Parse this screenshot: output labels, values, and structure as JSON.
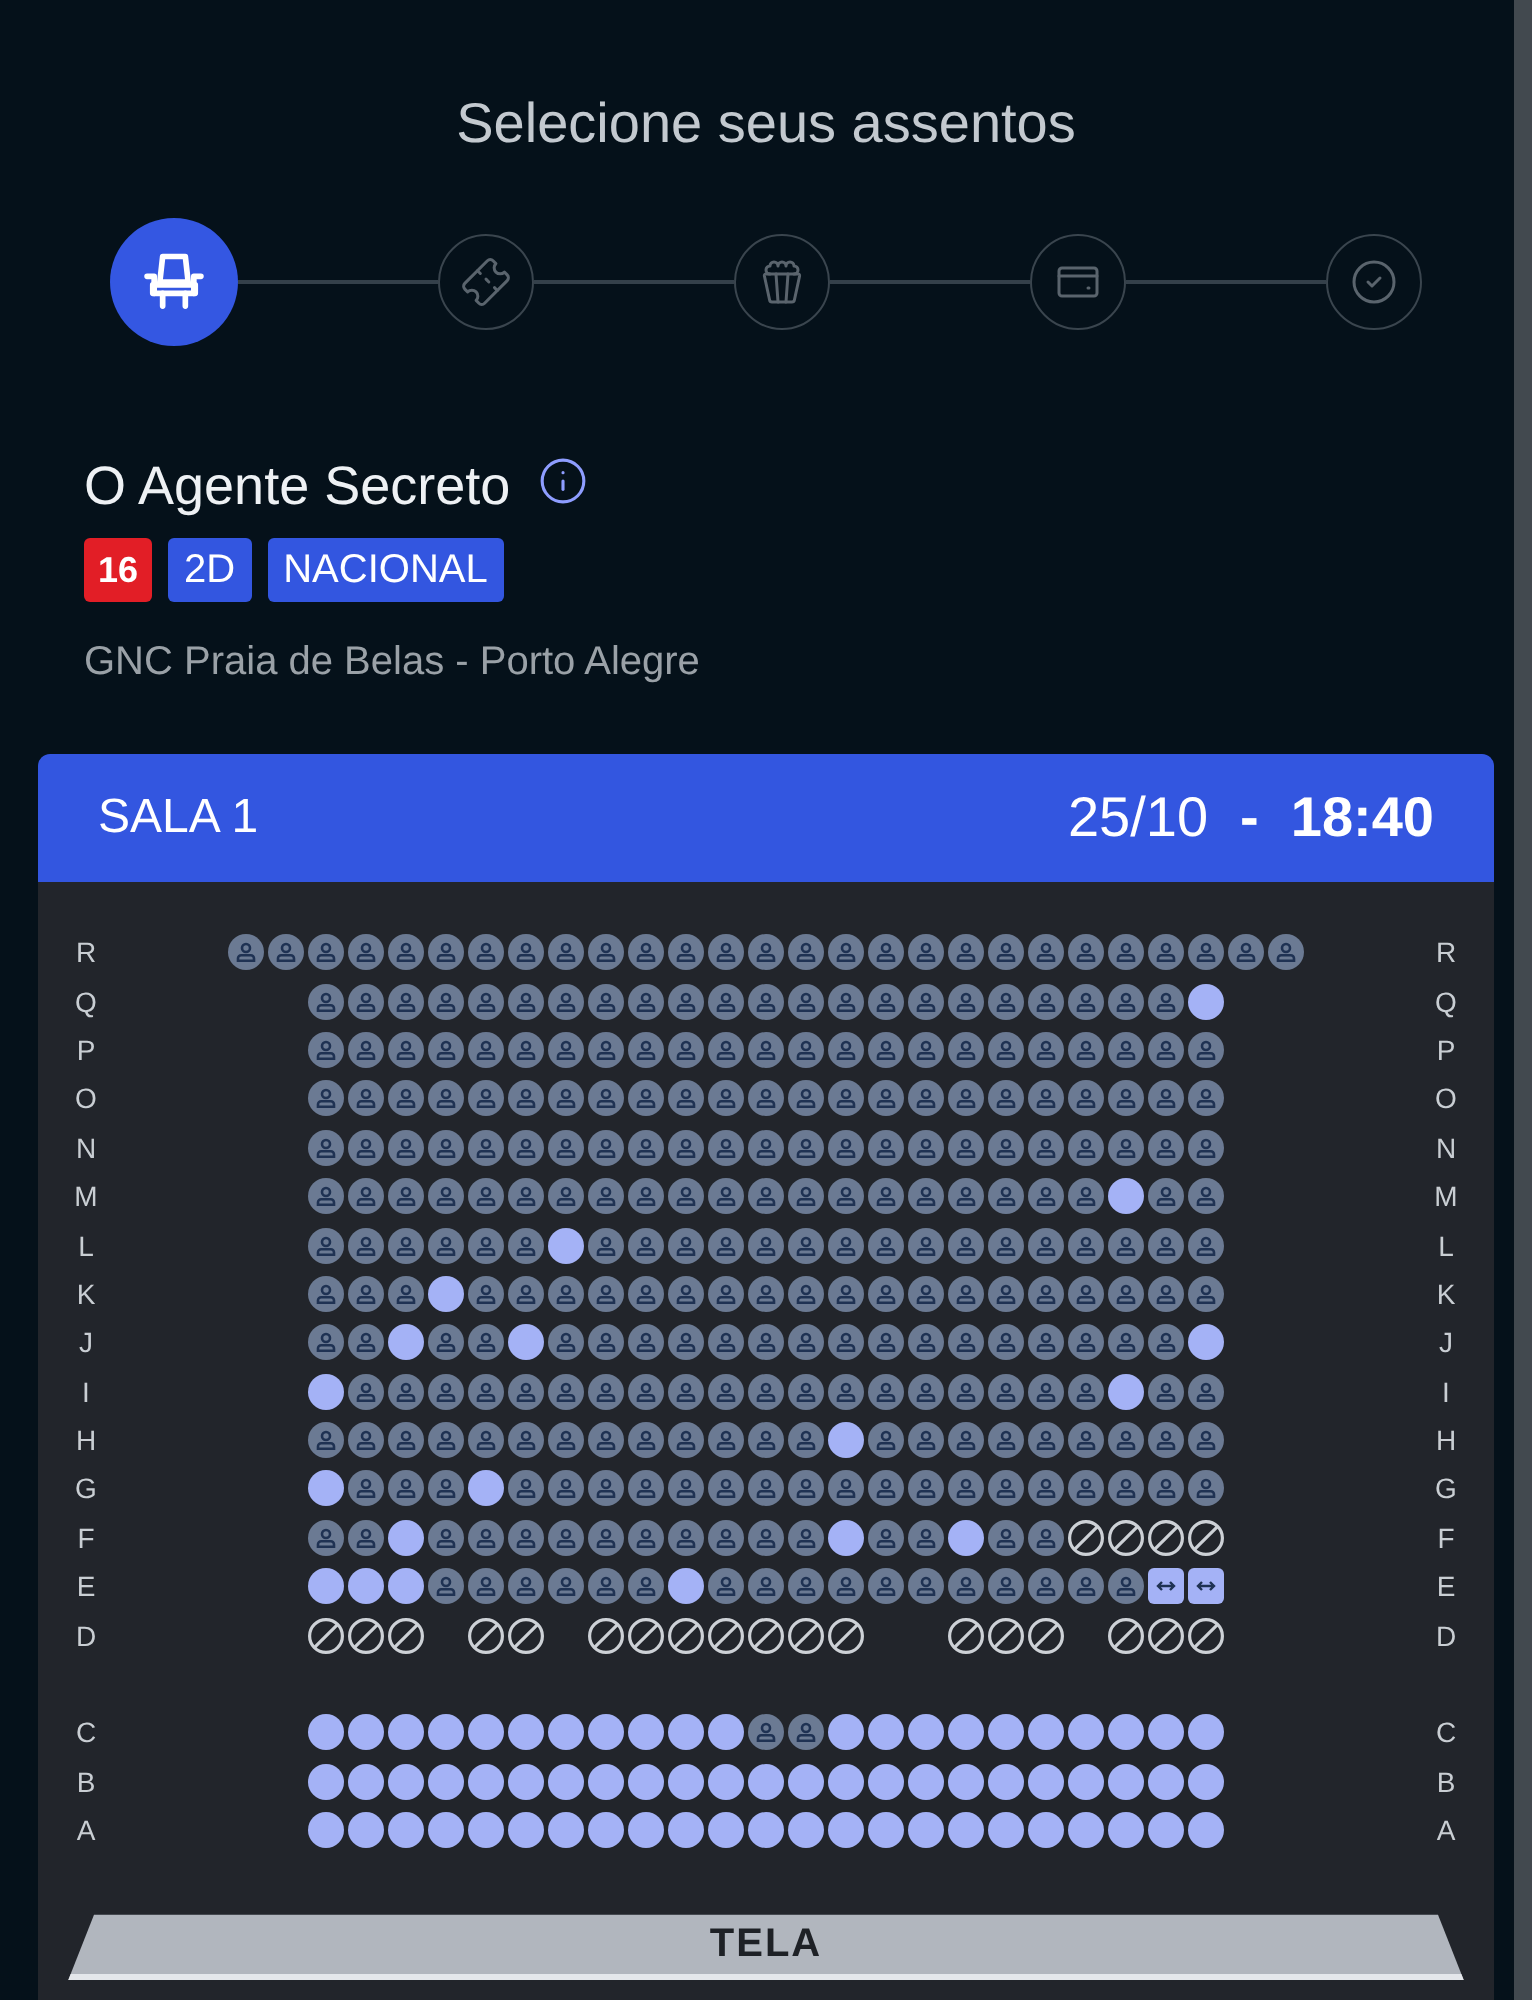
{
  "header": {
    "title": "Selecione seus assentos"
  },
  "steps": [
    {
      "kind": "seat",
      "selected": true
    },
    {
      "kind": "ticket",
      "selected": false
    },
    {
      "kind": "snack",
      "selected": false
    },
    {
      "kind": "payment",
      "selected": false
    },
    {
      "kind": "confirmation",
      "selected": false
    }
  ],
  "movie": {
    "title": "O Agente Secreto",
    "badges": [
      {
        "kind": "rating",
        "text": "16",
        "color": "#e21e26"
      },
      {
        "kind": "tag",
        "text": "2D",
        "color": "#3356e0"
      },
      {
        "kind": "tag",
        "text": "NACIONAL",
        "color": "#3356e0"
      }
    ],
    "location": "GNC Praia de Belas - Porto Alegre"
  },
  "session": {
    "room": "SALA 1",
    "date": "25/10",
    "separator": "-",
    "time": "18:40"
  },
  "seat_map": {
    "blocks": [
      {
        "rows": [
          {
            "label_left": "R",
            "label_right": "R",
            "seats": [
              {
                "kind": "taken"
              },
              {
                "kind": "taken"
              },
              {
                "kind": "taken"
              },
              {
                "kind": "taken"
              },
              {
                "kind": "taken"
              },
              {
                "kind": "taken"
              },
              {
                "kind": "taken"
              },
              {
                "kind": "taken"
              },
              {
                "kind": "taken"
              },
              {
                "kind": "taken"
              },
              {
                "kind": "taken"
              },
              {
                "kind": "taken"
              },
              {
                "kind": "taken"
              },
              {
                "kind": "taken"
              },
              {
                "kind": "taken"
              },
              {
                "kind": "taken"
              },
              {
                "kind": "taken"
              },
              {
                "kind": "taken"
              },
              {
                "kind": "taken"
              },
              {
                "kind": "taken"
              },
              {
                "kind": "taken"
              },
              {
                "kind": "taken"
              },
              {
                "kind": "taken"
              },
              {
                "kind": "taken"
              },
              {
                "kind": "taken"
              },
              {
                "kind": "taken"
              },
              {
                "kind": "taken"
              }
            ]
          },
          {
            "label_left": "Q",
            "label_right": "Q",
            "seats": [
              {
                "kind": "taken"
              },
              {
                "kind": "taken"
              },
              {
                "kind": "taken"
              },
              {
                "kind": "taken"
              },
              {
                "kind": "taken"
              },
              {
                "kind": "taken"
              },
              {
                "kind": "taken"
              },
              {
                "kind": "taken"
              },
              {
                "kind": "taken"
              },
              {
                "kind": "taken"
              },
              {
                "kind": "taken"
              },
              {
                "kind": "taken"
              },
              {
                "kind": "taken"
              },
              {
                "kind": "taken"
              },
              {
                "kind": "taken"
              },
              {
                "kind": "taken"
              },
              {
                "kind": "taken"
              },
              {
                "kind": "taken"
              },
              {
                "kind": "taken"
              },
              {
                "kind": "taken"
              },
              {
                "kind": "taken"
              },
              {
                "kind": "taken"
              },
              {
                "kind": "free"
              }
            ]
          },
          {
            "label_left": "P",
            "label_right": "P",
            "seats": [
              {
                "kind": "taken"
              },
              {
                "kind": "taken"
              },
              {
                "kind": "taken"
              },
              {
                "kind": "taken"
              },
              {
                "kind": "taken"
              },
              {
                "kind": "taken"
              },
              {
                "kind": "taken"
              },
              {
                "kind": "taken"
              },
              {
                "kind": "taken"
              },
              {
                "kind": "taken"
              },
              {
                "kind": "taken"
              },
              {
                "kind": "taken"
              },
              {
                "kind": "taken"
              },
              {
                "kind": "taken"
              },
              {
                "kind": "taken"
              },
              {
                "kind": "taken"
              },
              {
                "kind": "taken"
              },
              {
                "kind": "taken"
              },
              {
                "kind": "taken"
              },
              {
                "kind": "taken"
              },
              {
                "kind": "taken"
              },
              {
                "kind": "taken"
              },
              {
                "kind": "taken"
              }
            ]
          },
          {
            "label_left": "O",
            "label_right": "O",
            "seats": [
              {
                "kind": "taken"
              },
              {
                "kind": "taken"
              },
              {
                "kind": "taken"
              },
              {
                "kind": "taken"
              },
              {
                "kind": "taken"
              },
              {
                "kind": "taken"
              },
              {
                "kind": "taken"
              },
              {
                "kind": "taken"
              },
              {
                "kind": "taken"
              },
              {
                "kind": "taken"
              },
              {
                "kind": "taken"
              },
              {
                "kind": "taken"
              },
              {
                "kind": "taken"
              },
              {
                "kind": "taken"
              },
              {
                "kind": "taken"
              },
              {
                "kind": "taken"
              },
              {
                "kind": "taken"
              },
              {
                "kind": "taken"
              },
              {
                "kind": "taken"
              },
              {
                "kind": "taken"
              },
              {
                "kind": "taken"
              },
              {
                "kind": "taken"
              },
              {
                "kind": "taken"
              }
            ]
          },
          {
            "label_left": "N",
            "label_right": "N",
            "seats": [
              {
                "kind": "taken"
              },
              {
                "kind": "taken"
              },
              {
                "kind": "taken"
              },
              {
                "kind": "taken"
              },
              {
                "kind": "taken"
              },
              {
                "kind": "taken"
              },
              {
                "kind": "taken"
              },
              {
                "kind": "taken"
              },
              {
                "kind": "taken"
              },
              {
                "kind": "taken"
              },
              {
                "kind": "taken"
              },
              {
                "kind": "taken"
              },
              {
                "kind": "taken"
              },
              {
                "kind": "taken"
              },
              {
                "kind": "taken"
              },
              {
                "kind": "taken"
              },
              {
                "kind": "taken"
              },
              {
                "kind": "taken"
              },
              {
                "kind": "taken"
              },
              {
                "kind": "taken"
              },
              {
                "kind": "taken"
              },
              {
                "kind": "taken"
              },
              {
                "kind": "taken"
              }
            ]
          },
          {
            "label_left": "M",
            "label_right": "M",
            "seats": [
              {
                "kind": "taken"
              },
              {
                "kind": "taken"
              },
              {
                "kind": "taken"
              },
              {
                "kind": "taken"
              },
              {
                "kind": "taken"
              },
              {
                "kind": "taken"
              },
              {
                "kind": "taken"
              },
              {
                "kind": "taken"
              },
              {
                "kind": "taken"
              },
              {
                "kind": "taken"
              },
              {
                "kind": "taken"
              },
              {
                "kind": "taken"
              },
              {
                "kind": "taken"
              },
              {
                "kind": "taken"
              },
              {
                "kind": "taken"
              },
              {
                "kind": "taken"
              },
              {
                "kind": "taken"
              },
              {
                "kind": "taken"
              },
              {
                "kind": "taken"
              },
              {
                "kind": "taken"
              },
              {
                "kind": "free"
              },
              {
                "kind": "taken"
              },
              {
                "kind": "taken"
              }
            ]
          },
          {
            "label_left": "L",
            "label_right": "L",
            "seats": [
              {
                "kind": "taken"
              },
              {
                "kind": "taken"
              },
              {
                "kind": "taken"
              },
              {
                "kind": "taken"
              },
              {
                "kind": "taken"
              },
              {
                "kind": "taken"
              },
              {
                "kind": "free"
              },
              {
                "kind": "taken"
              },
              {
                "kind": "taken"
              },
              {
                "kind": "taken"
              },
              {
                "kind": "taken"
              },
              {
                "kind": "taken"
              },
              {
                "kind": "taken"
              },
              {
                "kind": "taken"
              },
              {
                "kind": "taken"
              },
              {
                "kind": "taken"
              },
              {
                "kind": "taken"
              },
              {
                "kind": "taken"
              },
              {
                "kind": "taken"
              },
              {
                "kind": "taken"
              },
              {
                "kind": "taken"
              },
              {
                "kind": "taken"
              },
              {
                "kind": "taken"
              }
            ]
          },
          {
            "label_left": "K",
            "label_right": "K",
            "seats": [
              {
                "kind": "taken"
              },
              {
                "kind": "taken"
              },
              {
                "kind": "taken"
              },
              {
                "kind": "free"
              },
              {
                "kind": "taken"
              },
              {
                "kind": "taken"
              },
              {
                "kind": "taken"
              },
              {
                "kind": "taken"
              },
              {
                "kind": "taken"
              },
              {
                "kind": "taken"
              },
              {
                "kind": "taken"
              },
              {
                "kind": "taken"
              },
              {
                "kind": "taken"
              },
              {
                "kind": "taken"
              },
              {
                "kind": "taken"
              },
              {
                "kind": "taken"
              },
              {
                "kind": "taken"
              },
              {
                "kind": "taken"
              },
              {
                "kind": "taken"
              },
              {
                "kind": "taken"
              },
              {
                "kind": "taken"
              },
              {
                "kind": "taken"
              },
              {
                "kind": "taken"
              }
            ]
          },
          {
            "label_left": "J",
            "label_right": "J",
            "seats": [
              {
                "kind": "taken"
              },
              {
                "kind": "taken"
              },
              {
                "kind": "free"
              },
              {
                "kind": "taken"
              },
              {
                "kind": "taken"
              },
              {
                "kind": "free"
              },
              {
                "kind": "taken"
              },
              {
                "kind": "taken"
              },
              {
                "kind": "taken"
              },
              {
                "kind": "taken"
              },
              {
                "kind": "taken"
              },
              {
                "kind": "taken"
              },
              {
                "kind": "taken"
              },
              {
                "kind": "taken"
              },
              {
                "kind": "taken"
              },
              {
                "kind": "taken"
              },
              {
                "kind": "taken"
              },
              {
                "kind": "taken"
              },
              {
                "kind": "taken"
              },
              {
                "kind": "taken"
              },
              {
                "kind": "taken"
              },
              {
                "kind": "taken"
              },
              {
                "kind": "free"
              }
            ]
          },
          {
            "label_left": "I",
            "label_right": "I",
            "seats": [
              {
                "kind": "free"
              },
              {
                "kind": "taken"
              },
              {
                "kind": "taken"
              },
              {
                "kind": "taken"
              },
              {
                "kind": "taken"
              },
              {
                "kind": "taken"
              },
              {
                "kind": "taken"
              },
              {
                "kind": "taken"
              },
              {
                "kind": "taken"
              },
              {
                "kind": "taken"
              },
              {
                "kind": "taken"
              },
              {
                "kind": "taken"
              },
              {
                "kind": "taken"
              },
              {
                "kind": "taken"
              },
              {
                "kind": "taken"
              },
              {
                "kind": "taken"
              },
              {
                "kind": "taken"
              },
              {
                "kind": "taken"
              },
              {
                "kind": "taken"
              },
              {
                "kind": "taken"
              },
              {
                "kind": "free"
              },
              {
                "kind": "taken"
              },
              {
                "kind": "taken"
              }
            ]
          },
          {
            "label_left": "H",
            "label_right": "H",
            "seats": [
              {
                "kind": "taken"
              },
              {
                "kind": "taken"
              },
              {
                "kind": "taken"
              },
              {
                "kind": "taken"
              },
              {
                "kind": "taken"
              },
              {
                "kind": "taken"
              },
              {
                "kind": "taken"
              },
              {
                "kind": "taken"
              },
              {
                "kind": "taken"
              },
              {
                "kind": "taken"
              },
              {
                "kind": "taken"
              },
              {
                "kind": "taken"
              },
              {
                "kind": "taken"
              },
              {
                "kind": "free"
              },
              {
                "kind": "taken"
              },
              {
                "kind": "taken"
              },
              {
                "kind": "taken"
              },
              {
                "kind": "taken"
              },
              {
                "kind": "taken"
              },
              {
                "kind": "taken"
              },
              {
                "kind": "taken"
              },
              {
                "kind": "taken"
              },
              {
                "kind": "taken"
              }
            ]
          },
          {
            "label_left": "G",
            "label_right": "G",
            "seats": [
              {
                "kind": "free"
              },
              {
                "kind": "taken"
              },
              {
                "kind": "taken"
              },
              {
                "kind": "taken"
              },
              {
                "kind": "free"
              },
              {
                "kind": "taken"
              },
              {
                "kind": "taken"
              },
              {
                "kind": "taken"
              },
              {
                "kind": "taken"
              },
              {
                "kind": "taken"
              },
              {
                "kind": "taken"
              },
              {
                "kind": "taken"
              },
              {
                "kind": "taken"
              },
              {
                "kind": "taken"
              },
              {
                "kind": "taken"
              },
              {
                "kind": "taken"
              },
              {
                "kind": "taken"
              },
              {
                "kind": "taken"
              },
              {
                "kind": "taken"
              },
              {
                "kind": "taken"
              },
              {
                "kind": "taken"
              },
              {
                "kind": "taken"
              },
              {
                "kind": "taken"
              }
            ]
          },
          {
            "label_left": "F",
            "label_right": "F",
            "seats": [
              {
                "kind": "taken"
              },
              {
                "kind": "taken"
              },
              {
                "kind": "free"
              },
              {
                "kind": "taken"
              },
              {
                "kind": "taken"
              },
              {
                "kind": "taken"
              },
              {
                "kind": "taken"
              },
              {
                "kind": "taken"
              },
              {
                "kind": "taken"
              },
              {
                "kind": "taken"
              },
              {
                "kind": "taken"
              },
              {
                "kind": "taken"
              },
              {
                "kind": "taken"
              },
              {
                "kind": "free"
              },
              {
                "kind": "taken"
              },
              {
                "kind": "taken"
              },
              {
                "kind": "free"
              },
              {
                "kind": "taken"
              },
              {
                "kind": "taken"
              },
              {
                "kind": "blocked"
              },
              {
                "kind": "blocked"
              },
              {
                "kind": "blocked"
              },
              {
                "kind": "blocked"
              }
            ]
          },
          {
            "label_left": "E",
            "label_right": "E",
            "seats": [
              {
                "kind": "free"
              },
              {
                "kind": "free"
              },
              {
                "kind": "free"
              },
              {
                "kind": "taken"
              },
              {
                "kind": "taken"
              },
              {
                "kind": "taken"
              },
              {
                "kind": "taken"
              },
              {
                "kind": "taken"
              },
              {
                "kind": "taken"
              },
              {
                "kind": "free"
              },
              {
                "kind": "taken"
              },
              {
                "kind": "taken"
              },
              {
                "kind": "taken"
              },
              {
                "kind": "taken"
              },
              {
                "kind": "taken"
              },
              {
                "kind": "taken"
              },
              {
                "kind": "taken"
              },
              {
                "kind": "taken"
              },
              {
                "kind": "taken"
              },
              {
                "kind": "taken"
              },
              {
                "kind": "taken"
              },
              {
                "kind": "special"
              },
              {
                "kind": "special"
              }
            ]
          },
          {
            "label_left": "D",
            "label_right": "D",
            "seats": [
              {
                "kind": "blocked"
              },
              {
                "kind": "blocked"
              },
              {
                "kind": "blocked"
              },
              {
                "kind": "gap"
              },
              {
                "kind": "blocked"
              },
              {
                "kind": "blocked"
              },
              {
                "kind": "gap"
              },
              {
                "kind": "blocked"
              },
              {
                "kind": "blocked"
              },
              {
                "kind": "blocked"
              },
              {
                "kind": "blocked"
              },
              {
                "kind": "blocked"
              },
              {
                "kind": "blocked"
              },
              {
                "kind": "blocked"
              },
              {
                "kind": "gap"
              },
              {
                "kind": "gap"
              },
              {
                "kind": "blocked"
              },
              {
                "kind": "blocked"
              },
              {
                "kind": "blocked"
              },
              {
                "kind": "gap"
              },
              {
                "kind": "blocked"
              },
              {
                "kind": "blocked"
              },
              {
                "kind": "blocked"
              }
            ]
          }
        ]
      },
      {
        "rows": [
          {
            "label_left": "C",
            "label_right": "C",
            "seats": [
              {
                "kind": "free"
              },
              {
                "kind": "free"
              },
              {
                "kind": "free"
              },
              {
                "kind": "free"
              },
              {
                "kind": "free"
              },
              {
                "kind": "free"
              },
              {
                "kind": "free"
              },
              {
                "kind": "free"
              },
              {
                "kind": "free"
              },
              {
                "kind": "free"
              },
              {
                "kind": "free"
              },
              {
                "kind": "taken"
              },
              {
                "kind": "taken"
              },
              {
                "kind": "free"
              },
              {
                "kind": "free"
              },
              {
                "kind": "free"
              },
              {
                "kind": "free"
              },
              {
                "kind": "free"
              },
              {
                "kind": "free"
              },
              {
                "kind": "free"
              },
              {
                "kind": "free"
              },
              {
                "kind": "free"
              },
              {
                "kind": "free"
              }
            ]
          },
          {
            "label_left": "B",
            "label_right": "B",
            "seats": [
              {
                "kind": "free"
              },
              {
                "kind": "free"
              },
              {
                "kind": "free"
              },
              {
                "kind": "free"
              },
              {
                "kind": "free"
              },
              {
                "kind": "free"
              },
              {
                "kind": "free"
              },
              {
                "kind": "free"
              },
              {
                "kind": "free"
              },
              {
                "kind": "free"
              },
              {
                "kind": "free"
              },
              {
                "kind": "free"
              },
              {
                "kind": "free"
              },
              {
                "kind": "free"
              },
              {
                "kind": "free"
              },
              {
                "kind": "free"
              },
              {
                "kind": "free"
              },
              {
                "kind": "free"
              },
              {
                "kind": "free"
              },
              {
                "kind": "free"
              },
              {
                "kind": "free"
              },
              {
                "kind": "free"
              },
              {
                "kind": "free"
              }
            ]
          },
          {
            "label_left": "A",
            "label_right": "A",
            "seats": [
              {
                "kind": "free"
              },
              {
                "kind": "free"
              },
              {
                "kind": "free"
              },
              {
                "kind": "free"
              },
              {
                "kind": "free"
              },
              {
                "kind": "free"
              },
              {
                "kind": "free"
              },
              {
                "kind": "free"
              },
              {
                "kind": "free"
              },
              {
                "kind": "free"
              },
              {
                "kind": "free"
              },
              {
                "kind": "free"
              },
              {
                "kind": "free"
              },
              {
                "kind": "free"
              },
              {
                "kind": "free"
              },
              {
                "kind": "free"
              },
              {
                "kind": "free"
              },
              {
                "kind": "free"
              },
              {
                "kind": "free"
              },
              {
                "kind": "free"
              },
              {
                "kind": "free"
              },
              {
                "kind": "free"
              },
              {
                "kind": "free"
              }
            ]
          }
        ]
      }
    ]
  },
  "screen": {
    "label": "TELA"
  }
}
